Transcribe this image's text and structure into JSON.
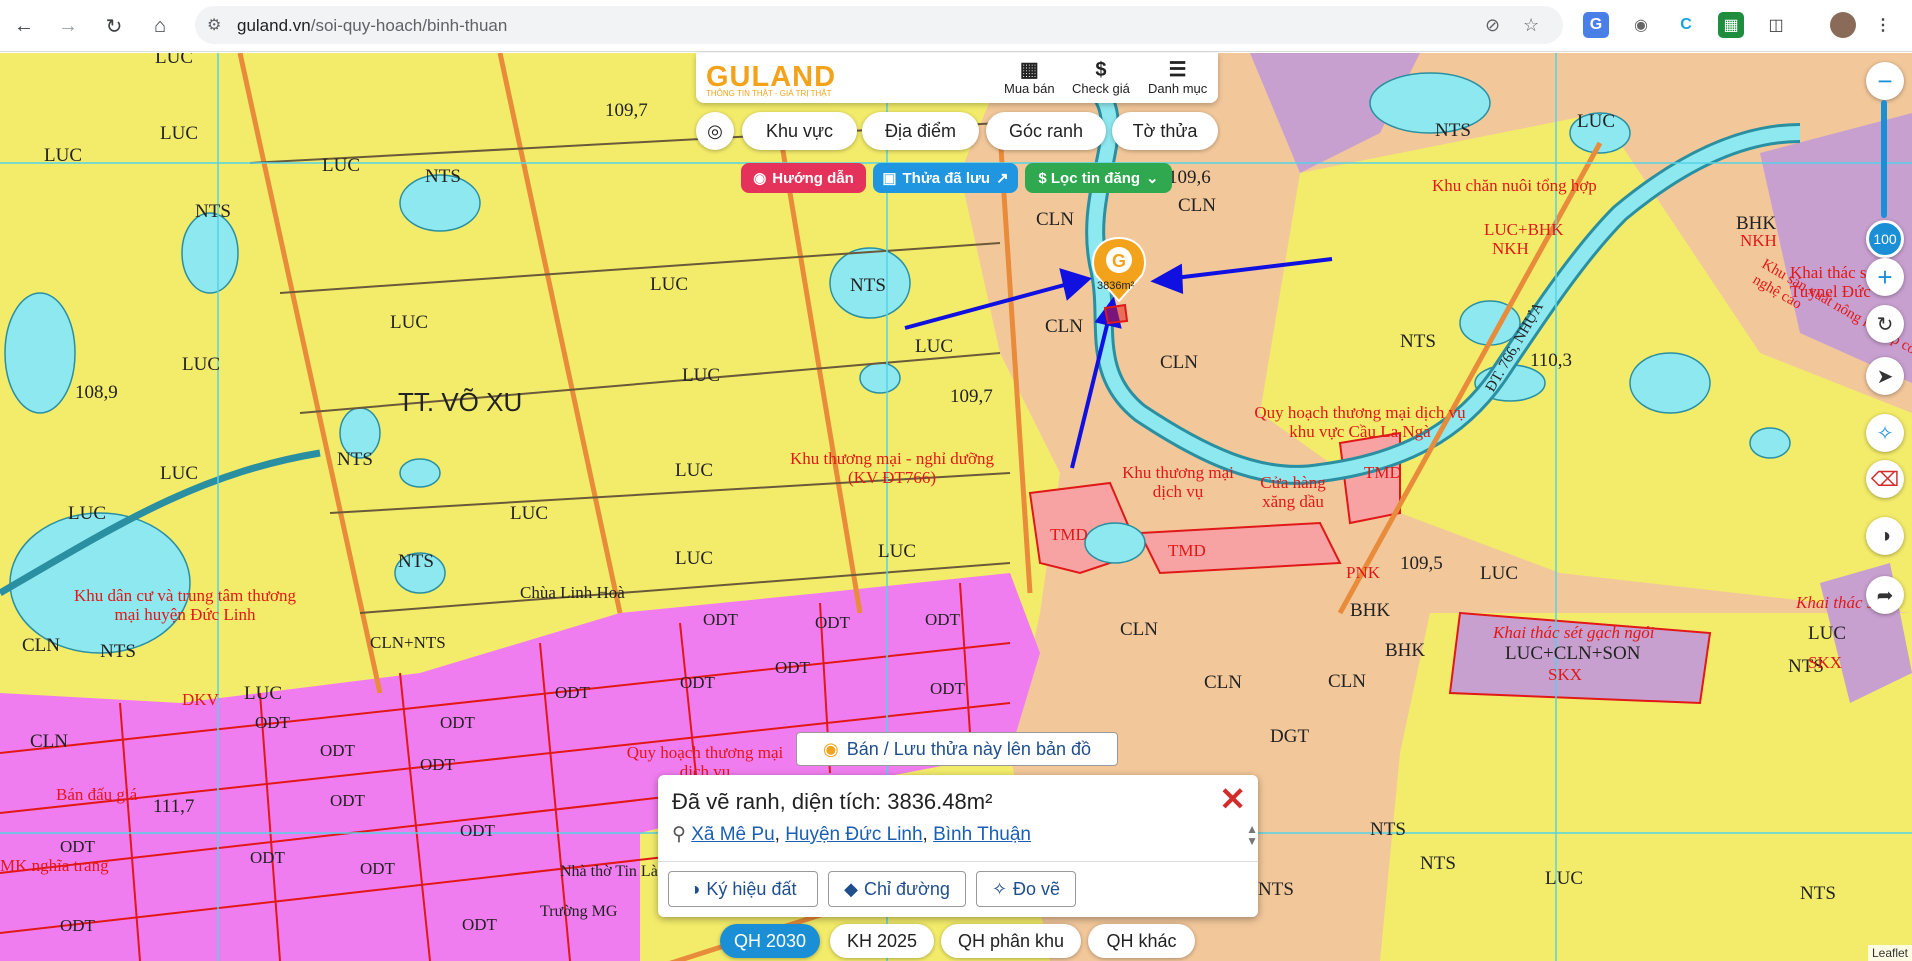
{
  "browser": {
    "url_domain": "guland.vn",
    "url_path": "/soi-quy-hoach/binh-thuan"
  },
  "header": {
    "logo": "GULAND",
    "tagline": "THÔNG TIN THẬT - GIÁ TRỊ THẬT",
    "actions": [
      {
        "label": "Mua bán",
        "icon": "building-icon"
      },
      {
        "label": "Check giá",
        "icon": "dollar-icon"
      },
      {
        "label": "Danh mục",
        "icon": "menu-icon"
      }
    ]
  },
  "toolbar": {
    "tabs": [
      "Khu vực",
      "Địa điểm",
      "Góc ranh",
      "Tờ thửa"
    ],
    "guide": "Hướng dẫn",
    "saved": "Thửa đã lưu",
    "filter": "$ Lọc tin đăng"
  },
  "map": {
    "labels": {
      "luc": "LUC",
      "nts": "NTS",
      "cln": "CLN",
      "odt": "ODT",
      "bhk": "BHK",
      "skx": "SKX",
      "dgt": "DGT",
      "nkh": "NKH",
      "pnk": "PNK",
      "tmd": "TMD",
      "dkv": "DKV",
      "town": "TT. VÕ XU",
      "luc_bhk": "LUC+BHK",
      "cln_nts": "CLN+NTS",
      "luc_cln_son": "LUC+CLN+SON",
      "e1097a": "109,7",
      "e1097b": "109,7",
      "e1096": "109,6",
      "e1103": "110,3",
      "e1095": "109,5",
      "e1089": "108,9",
      "e1117": "111,7",
      "road": "ĐT. 766, NHỰA",
      "pagoda": "Chùa Linh Hoà",
      "church": "Nhà thờ Tin Lành",
      "school": "Trường MG",
      "zone_commerce": "Khu thương mại - nghỉ dưỡng (KV ĐT766)",
      "zone_trade": "Khu thương mại dịch vụ",
      "zone_shop": "Cửa hàng xăng dầu",
      "zone_plan": "Quy hoạch thương mại dịch vụ khu vực Cầu La Ngà",
      "zone_livestock": "Khu chăn nuôi tổng hợp",
      "zone_residential": "Khu dân cư và trung tâm thương mại huyện Đức Linh",
      "zone_quarry": "Khai thác sét gạch ngói",
      "zone_quarry2": "Khai thác sét g",
      "zone_urbanplan": "Quy hoạch thương mại dịch vụ",
      "zone_auction": "Bán đấu giá",
      "zone_cemetery": "MK nghĩa trang",
      "zone_agri": "Khu sản xuất nông nghiệp công nghệ cao",
      "zone_tuynel": "Khai thác sét Tuynel Đức",
      "marker_area": "3836m²"
    }
  },
  "map_controls": {
    "zoom_level": "100"
  },
  "popup_cta": "Bán / Lưu thửa này lên bản đồ",
  "popup": {
    "title": "Đã vẽ ranh, diện tích: 3836.48m²",
    "commune": "Xã Mê Pu",
    "district": "Huyện Đức Linh",
    "province": "Bình Thuận",
    "btn_symbol": "Ký hiệu đất",
    "btn_direction": "Chỉ đường",
    "btn_measure": "Đo vẽ"
  },
  "bottom_tabs": [
    "QH 2030",
    "KH 2025",
    "QH phân khu",
    "QH khác"
  ],
  "attribution": "Leaflet",
  "colors": {
    "luc": "#f3ec6a",
    "nts": "#8ee8f0",
    "cln": "#f2c79a",
    "odt": "#f07df0",
    "tmd": "#f7a3a3",
    "skx": "#c8a0d0",
    "accent": "#1a8fd6",
    "annotation_arrow": "#1010e0"
  }
}
